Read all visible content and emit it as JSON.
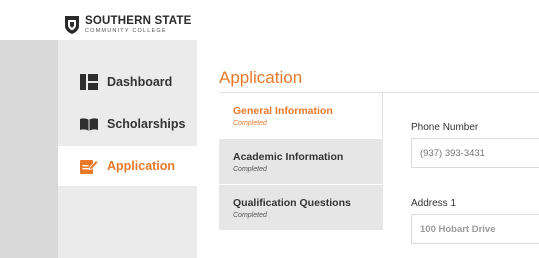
{
  "brand": {
    "name_line1": "SOUTHERN STATE",
    "name_line2": "COMMUNITY COLLEGE"
  },
  "colors": {
    "accent": "#e8792a",
    "sidebar_bg": "#ebebeb",
    "gutter_bg": "#d9d9d9"
  },
  "sidebar": {
    "items": [
      {
        "label": "Dashboard",
        "icon": "dashboard-icon",
        "active": false
      },
      {
        "label": "Scholarships",
        "icon": "open-book-icon",
        "active": false
      },
      {
        "label": "Application",
        "icon": "edit-document-icon",
        "active": true
      }
    ]
  },
  "main": {
    "title": "Application",
    "steps": [
      {
        "title": "General Information",
        "status": "Completed",
        "active": true
      },
      {
        "title": "Academic Information",
        "status": "Completed",
        "active": false
      },
      {
        "title": "Qualification Questions",
        "status": "Completed",
        "active": false
      }
    ],
    "form": {
      "phone": {
        "label": "Phone Number",
        "placeholder": "(937) 393-3431"
      },
      "address1": {
        "label": "Address 1",
        "value": "100 Hobart Drive"
      }
    }
  }
}
